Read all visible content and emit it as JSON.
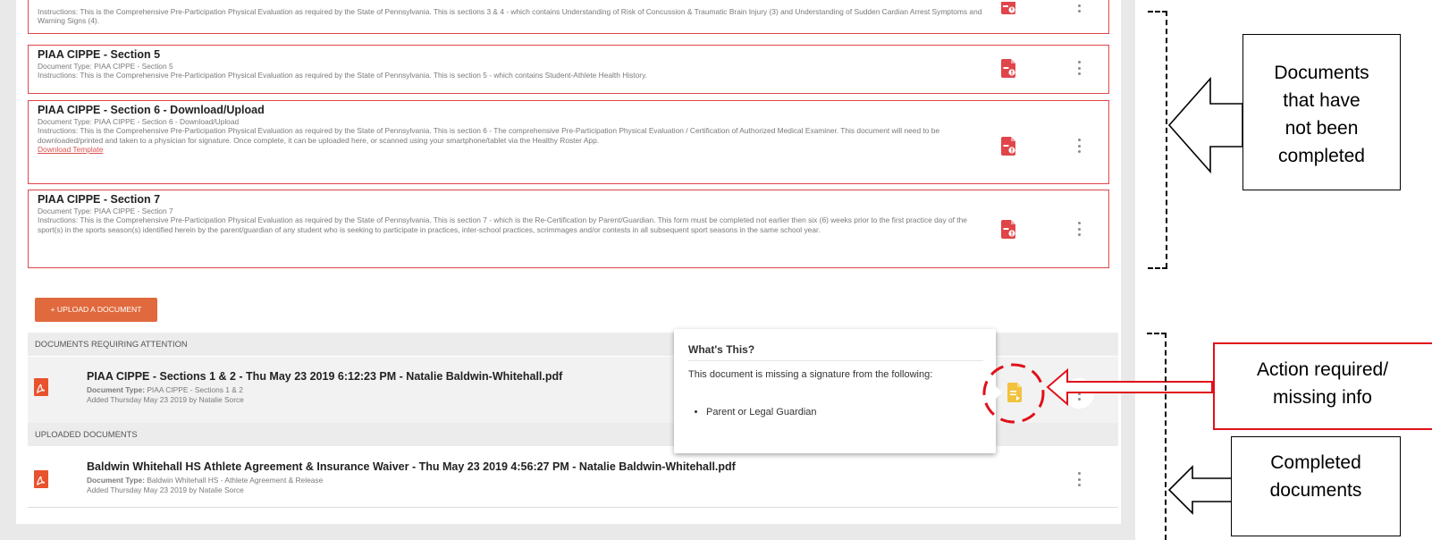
{
  "required_documents": [
    {
      "title": "",
      "document_type": "",
      "instructions": "Instructions: This is the Comprehensive Pre-Participation Physical Evaluation as required by the State of Pennsylvania. This is sections 3 & 4 - which contains Understanding of Risk of Concussion & Traumatic Brain Injury (3) and Understanding of Sudden Cardian Arrest Symptoms and Warning Signs (4)."
    },
    {
      "title": "PIAA CIPPE - Section 5",
      "document_type": "Document Type: PIAA CIPPE - Section 5",
      "instructions": "Instructions: This is the Comprehensive Pre-Participation Physical Evaluation as required by the State of Pennsylvania. This is section 5 - which contains Student-Athlete Health History."
    },
    {
      "title": "PIAA CIPPE - Section 6 - Download/Upload",
      "document_type": "Document Type: PIAA CIPPE - Section 6 - Download/Upload",
      "instructions": "Instructions: This is the Comprehensive Pre-Participation Physical Evaluation as required by the State of Pennsylvania. This is section 6 - The comprehensive Pre-Participation Physical Evaluation / Certification of Authorized Medical Examiner. This document will need to be downloaded/printed and taken to a physician for signature. Once complete, it can be uploaded here, or scanned using your smartphone/tablet via the Healthy Roster App.",
      "link": "Download Template"
    },
    {
      "title": "PIAA CIPPE - Section 7",
      "document_type": "Document Type: PIAA CIPPE - Section 7",
      "instructions": "Instructions: This is the Comprehensive Pre-Participation Physical Evaluation as required by the State of Pennsylvania. This is section 7 - which is the Re-Certification by Parent/Guardian. This form must be completed not earlier then six (6) weeks prior to the first practice day of the sport(s) in the sports season(s) identified herein by the parent/guardian of any student who is seeking to participate in practices, inter-school practices, scrimmages and/or contests in all subsequent sport seasons in the same school year."
    }
  ],
  "upload_button": "+ UPLOAD A DOCUMENT",
  "attention_section": {
    "header": "DOCUMENTS REQUIRING ATTENTION",
    "items": [
      {
        "title": "PIAA CIPPE - Sections 1 & 2 - Thu May 23 2019 6:12:23 PM - Natalie Baldwin-Whitehall.pdf",
        "type_label": "Document Type:",
        "type_value": "PIAA CIPPE - Sections 1 & 2",
        "added": "Added Thursday May 23 2019 by Natalie Sorce"
      }
    ]
  },
  "uploaded_section": {
    "header": "UPLOADED DOCUMENTS",
    "items": [
      {
        "title": "Baldwin Whitehall HS Athlete Agreement & Insurance Waiver - Thu May 23 2019 4:56:27 PM - Natalie Baldwin-Whitehall.pdf",
        "type_label": "Document Type:",
        "type_value": "Baldwin Whitehall HS - Athlete Agreement & Release",
        "added": "Added Thursday May 23 2019 by Natalie Sorce"
      }
    ]
  },
  "popover": {
    "title": "What's This?",
    "text": "This document is missing a signature from the following:",
    "items": [
      "Parent or Legal Guardian"
    ]
  },
  "annotations": {
    "not_completed": [
      "Documents",
      "that have",
      "not been",
      "completed"
    ],
    "action_required": [
      "Action required/",
      "missing info"
    ],
    "completed": [
      "Completed",
      "documents"
    ]
  },
  "colors": {
    "card_border": "#e0454a",
    "upload_button": "#e06a3e",
    "pdf_icon": "#e8522d",
    "warning_icon": "#f2c23c",
    "annotation_red": "#e0101a"
  },
  "icons": {
    "required_doc": "file-alert-icon",
    "uploaded_doc": "pdf-file-icon",
    "action_required": "file-warning-icon",
    "menu": "kebab-menu-icon"
  }
}
